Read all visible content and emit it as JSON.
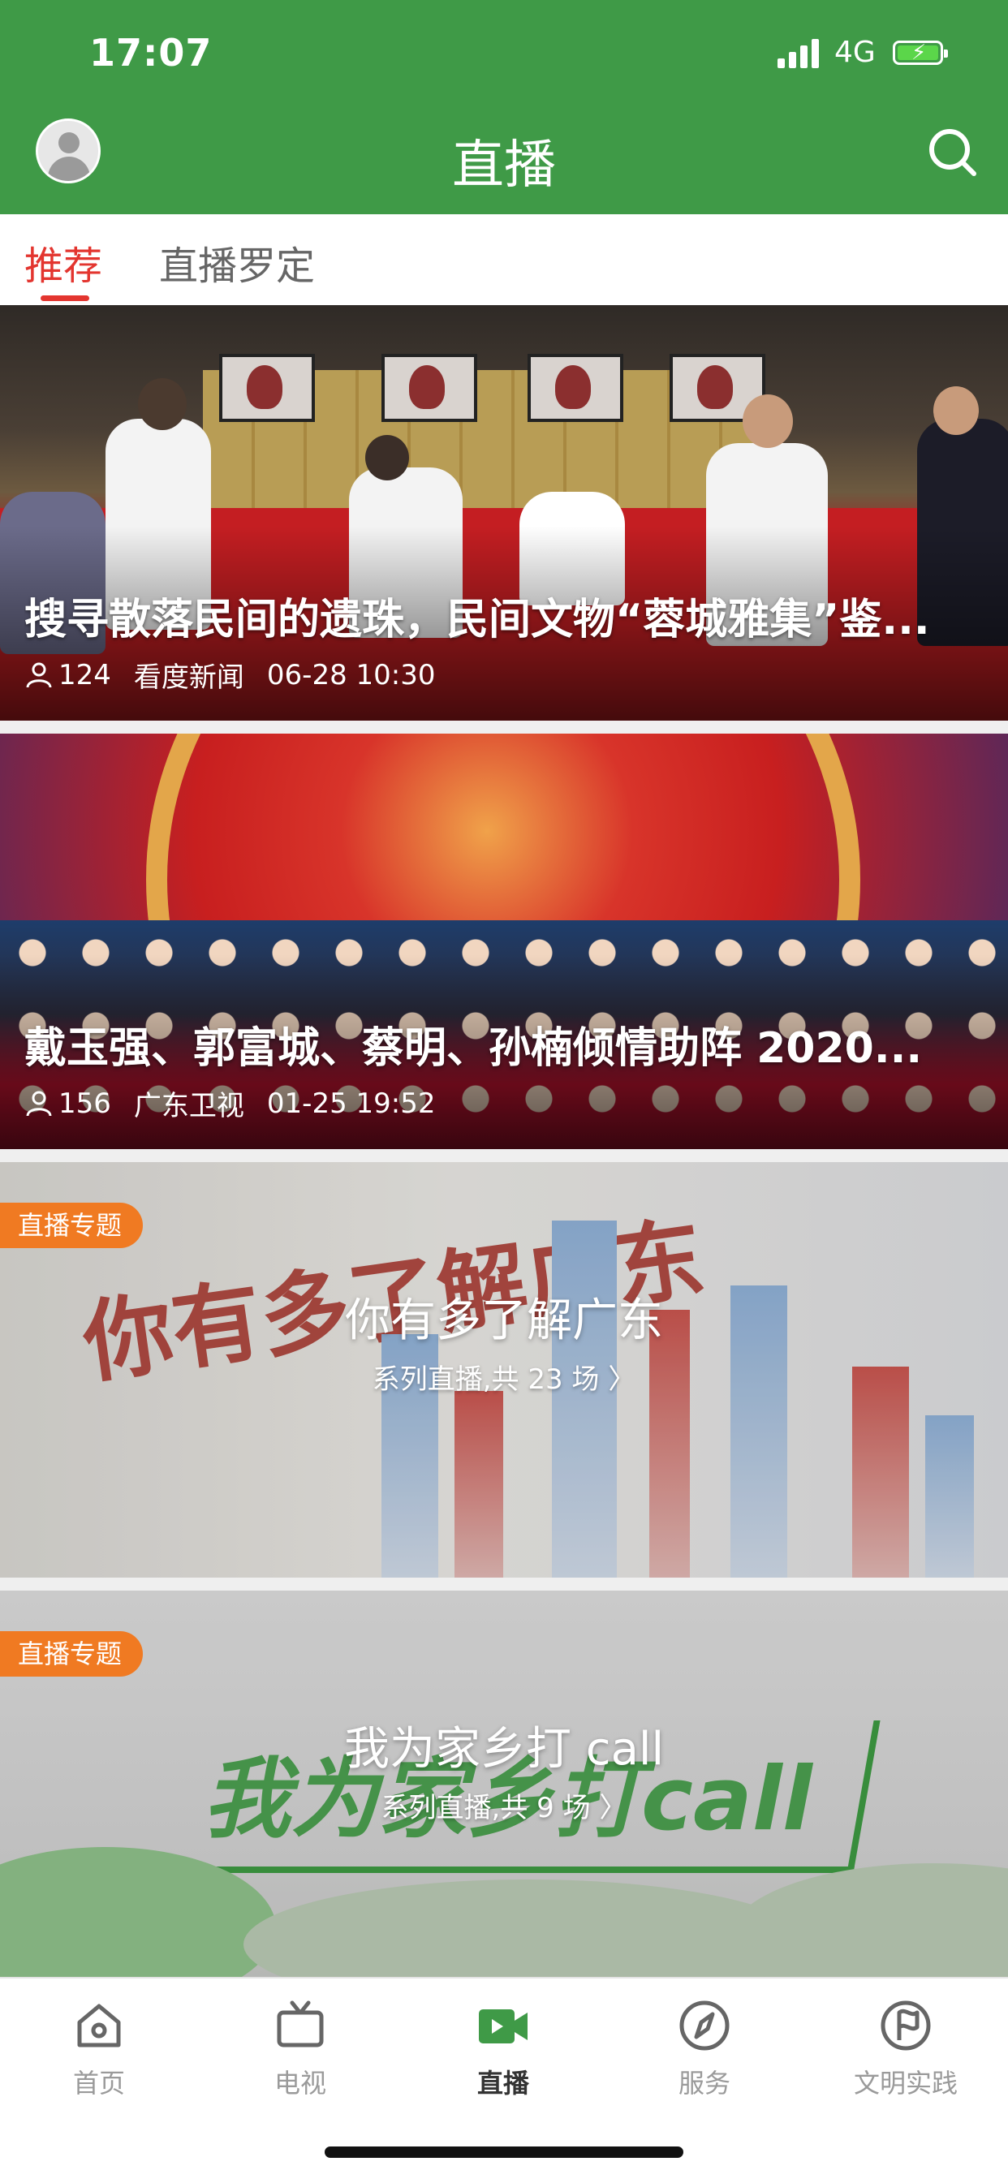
{
  "status_bar": {
    "time": "17:07",
    "network": "4G"
  },
  "nav": {
    "title": "直播"
  },
  "tabs": [
    {
      "label": "推荐",
      "active": true
    },
    {
      "label": "直播罗定",
      "active": false
    }
  ],
  "feed": [
    {
      "title": "搜寻散落民间的遗珠，民间文物“蓉城雅集”鉴...",
      "viewers": "124",
      "source": "看度新闻",
      "time": "06-28 10:30"
    },
    {
      "title": "戴玉强、郭富城、蔡明、孙楠倾情助阵 2020...",
      "viewers": "156",
      "source": "广东卫视",
      "time": "01-25 19:52"
    }
  ],
  "topics": [
    {
      "badge": "直播专题",
      "title": "你有多了解广东",
      "subtitle": "系列直播,共 23 场 〉",
      "art_text": "你有多了解广东"
    },
    {
      "badge": "直播专题",
      "title": "我为家乡打 call",
      "subtitle": "系列直播,共 9 场 〉",
      "art_text": "我为家乡打call"
    }
  ],
  "bottom_tabs": [
    {
      "label": "首页",
      "icon": "home-icon"
    },
    {
      "label": "电视",
      "icon": "tv-icon"
    },
    {
      "label": "直播",
      "icon": "live-video-icon",
      "active": true
    },
    {
      "label": "服务",
      "icon": "compass-icon"
    },
    {
      "label": "文明实践",
      "icon": "flag-icon"
    }
  ],
  "colors": {
    "brand_green": "#3f9a47",
    "accent_red": "#e3352f",
    "badge_orange": "#f07a22"
  }
}
